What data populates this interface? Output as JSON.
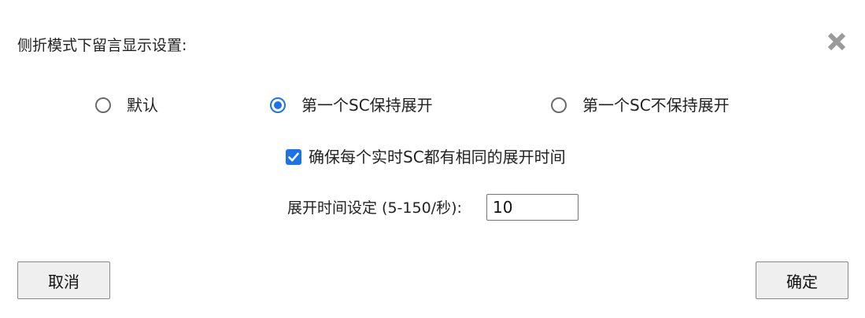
{
  "dialog": {
    "title": "侧折模式下留言显示设置:"
  },
  "close_button": {
    "icon": "close-icon",
    "color": "#9a9a9a"
  },
  "display_mode": {
    "options": [
      {
        "label": "默认",
        "checked": false
      },
      {
        "label": "第一个SC保持展开",
        "checked": true
      },
      {
        "label": "第一个SC不保持展开",
        "checked": false
      }
    ]
  },
  "same_duration_checkbox": {
    "label": "确保每个实时SC都有相同的展开时间",
    "checked": true
  },
  "duration": {
    "label": "展开时间设定 (5-150/秒):",
    "value": "10"
  },
  "buttons": {
    "cancel": "取消",
    "ok": "确定"
  },
  "colors": {
    "accent": "#1a73e8",
    "button_bg": "#efefef"
  }
}
